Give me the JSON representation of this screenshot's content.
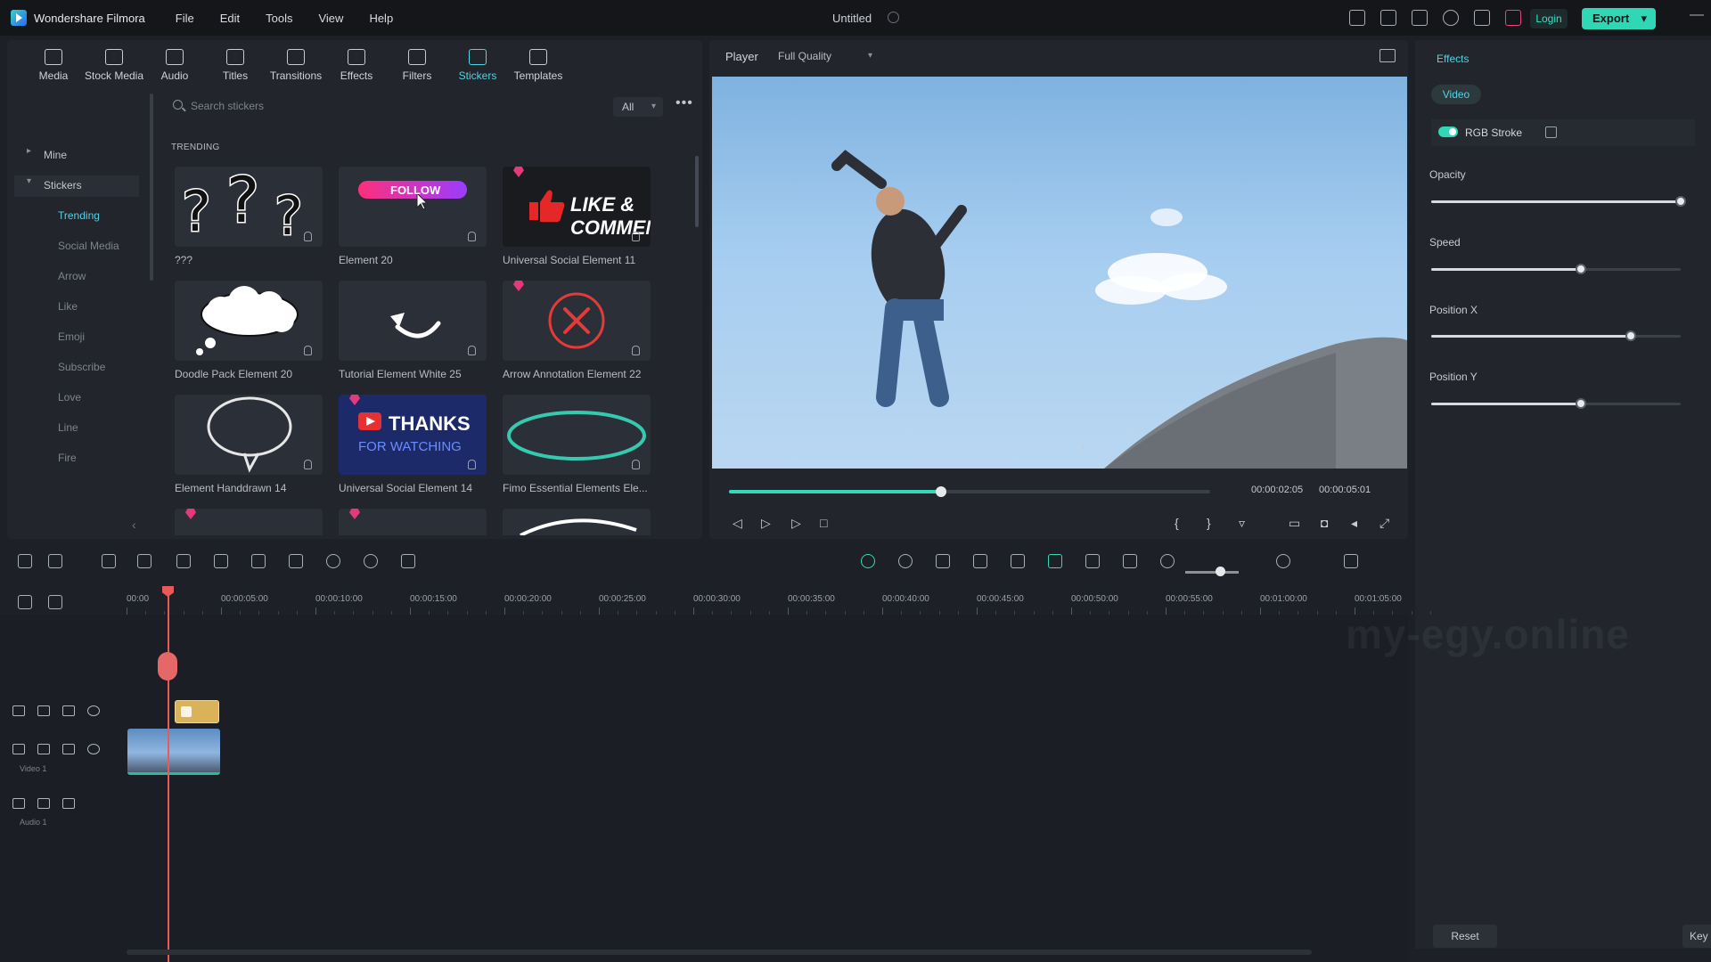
{
  "app": {
    "name": "Wondershare Filmora",
    "doc_title": "Untitled",
    "menu": [
      "File",
      "Edit",
      "Tools",
      "View",
      "Help"
    ],
    "login": "Login",
    "export": "Export"
  },
  "library": {
    "tabs": [
      {
        "label": "Media",
        "icon": "media-icon"
      },
      {
        "label": "Stock Media",
        "icon": "stock-media-icon"
      },
      {
        "label": "Audio",
        "icon": "audio-icon"
      },
      {
        "label": "Titles",
        "icon": "titles-icon"
      },
      {
        "label": "Transitions",
        "icon": "transitions-icon"
      },
      {
        "label": "Effects",
        "icon": "effects-icon"
      },
      {
        "label": "Filters",
        "icon": "filters-icon"
      },
      {
        "label": "Stickers",
        "icon": "stickers-icon",
        "active": true
      },
      {
        "label": "Templates",
        "icon": "templates-icon"
      }
    ],
    "sidebar": {
      "mine": "Mine",
      "stickers": "Stickers",
      "items": [
        "Trending",
        "Social Media",
        "Arrow",
        "Like",
        "Emoji",
        "Subscribe",
        "Love",
        "Line",
        "Fire"
      ],
      "active": "Trending"
    },
    "search_placeholder": "Search stickers",
    "filter": "All",
    "section": "TRENDING",
    "stickers": [
      {
        "name": "???",
        "style": "question"
      },
      {
        "name": "Element 20",
        "style": "follow",
        "label": "FOLLOW"
      },
      {
        "name": "Universal Social Element 11",
        "style": "like",
        "label": "LIKE & COMMENT",
        "premium": true
      },
      {
        "name": "Doodle Pack Element 20",
        "style": "cloud"
      },
      {
        "name": "Tutorial Element White 25",
        "style": "arrow"
      },
      {
        "name": "Arrow Annotation Element 22",
        "style": "x-circle",
        "premium": true
      },
      {
        "name": "Element Handdrawn 14",
        "style": "bubble"
      },
      {
        "name": "Universal Social Element 14",
        "style": "thanks",
        "label": "THANKS",
        "sublabel": "FOR WATCHING",
        "premium": true
      },
      {
        "name": "Fimo Essential Elements Ele...",
        "style": "ellipse"
      }
    ]
  },
  "player": {
    "label": "Player",
    "quality": "Full Quality",
    "current_time": "00:00:02:05",
    "total_time": "00:00:05:01",
    "progress": 0.44
  },
  "properties": {
    "tab": "Effects",
    "subtab": "Video",
    "effect_name": "RGB Stroke",
    "enabled": true,
    "sliders": [
      {
        "label": "Opacity",
        "value": 1.0
      },
      {
        "label": "Speed",
        "value": 0.6
      },
      {
        "label": "Position X",
        "value": 0.8
      },
      {
        "label": "Position Y",
        "value": 0.6
      }
    ],
    "reset": "Reset",
    "keyframe": "Key"
  },
  "timeline": {
    "ruler": [
      "00:00",
      "00:00:05:00",
      "00:00:10:00",
      "00:00:15:00",
      "00:00:20:00",
      "00:00:25:00",
      "00:00:30:00",
      "00:00:35:00",
      "00:00:40:00",
      "00:00:45:00",
      "00:00:50:00",
      "00:00:55:00",
      "00:01:00:00",
      "00:01:05:00"
    ],
    "tracks": [
      {
        "index": "2",
        "name": ""
      },
      {
        "index": "1",
        "name": "Video 1"
      },
      {
        "index": "1",
        "name": "Audio 1"
      }
    ]
  },
  "watermark": "my-egy.online",
  "colors": {
    "accent": "#35d8b7",
    "active_tab": "#4fd4e6",
    "playhead": "#e85a5a",
    "premium": "#e53a7a"
  }
}
